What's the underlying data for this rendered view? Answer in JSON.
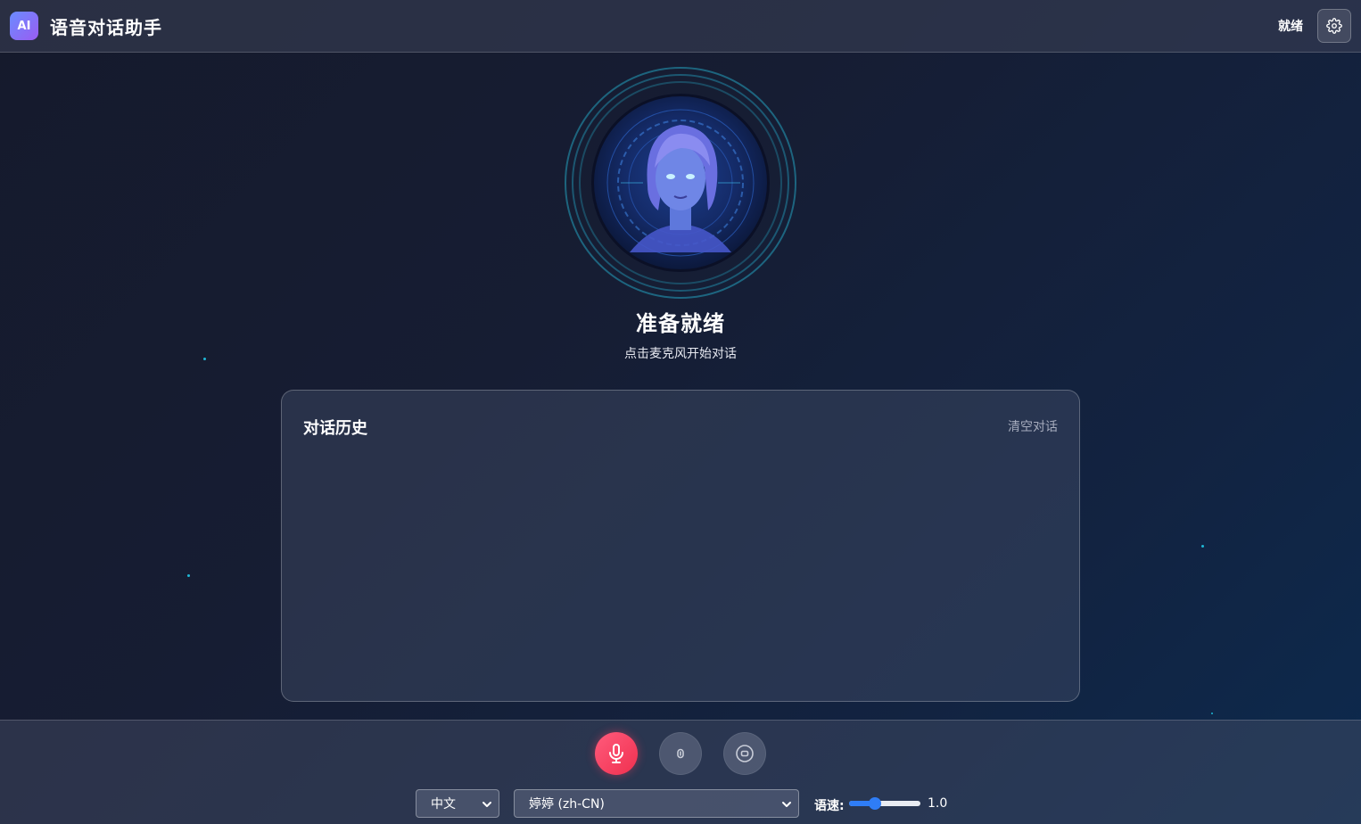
{
  "header": {
    "logo_text": "AI",
    "title": "语音对话助手",
    "status": "就绪",
    "settings_icon": "gear-icon"
  },
  "avatar": {
    "icon": "ai-avatar-face"
  },
  "state": {
    "title": "准备就绪",
    "subtitle": "点击麦克风开始对话"
  },
  "history": {
    "title": "对话历史",
    "clear_label": "清空对话",
    "messages": []
  },
  "controls": {
    "mic_icon": "microphone-icon",
    "pause_icon": "pause-icon",
    "stop_icon": "stop-icon",
    "language": {
      "selected": "中文"
    },
    "voice": {
      "selected": "婷婷 (zh-CN)"
    },
    "speed": {
      "label": "语速:",
      "value": "1.0",
      "fraction": 0.33
    }
  },
  "colors": {
    "accent": "#2f7df6",
    "mic": "#f0304f",
    "logo_start": "#6a8cff",
    "logo_end": "#9a5cf2",
    "ring": "#24a0be"
  }
}
